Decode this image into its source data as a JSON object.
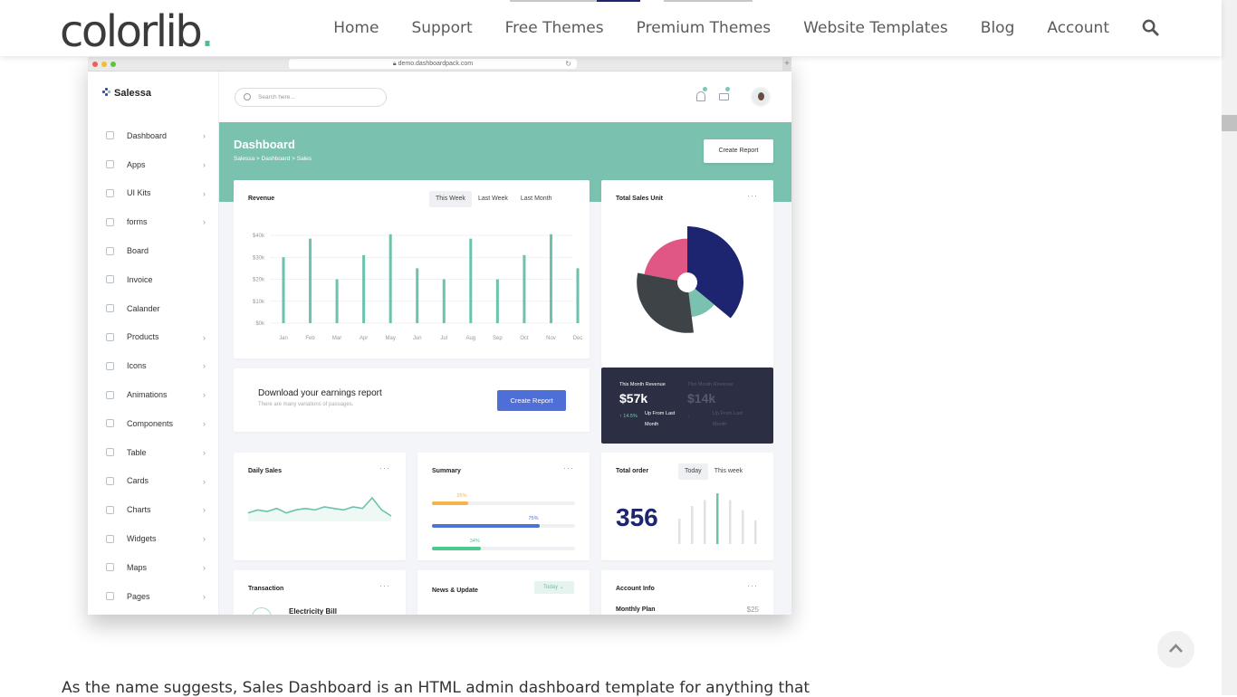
{
  "site": {
    "logo_text": "colorlib",
    "logo_dot": ".",
    "nav": [
      "Home",
      "Support",
      "Free Themes",
      "Premium Themes",
      "Website Templates",
      "Blog",
      "Account"
    ],
    "search_icon": "search-icon"
  },
  "browser": {
    "url": "demo.dashboardpack.com"
  },
  "app": {
    "brand": "Salessa",
    "search_placeholder": "Search here...",
    "menu": [
      {
        "label": "Dashboard",
        "chevron": true
      },
      {
        "label": "Apps",
        "chevron": true
      },
      {
        "label": "UI Kits",
        "chevron": true
      },
      {
        "label": "forms",
        "chevron": true
      },
      {
        "label": "Board",
        "chevron": false
      },
      {
        "label": "Invoice",
        "chevron": false
      },
      {
        "label": "Calander",
        "chevron": false
      },
      {
        "label": "Products",
        "chevron": true
      },
      {
        "label": "Icons",
        "chevron": true
      },
      {
        "label": "Animations",
        "chevron": true
      },
      {
        "label": "Components",
        "chevron": true
      },
      {
        "label": "Table",
        "chevron": true
      },
      {
        "label": "Cards",
        "chevron": true
      },
      {
        "label": "Charts",
        "chevron": true
      },
      {
        "label": "Widgets",
        "chevron": true
      },
      {
        "label": "Maps",
        "chevron": true
      },
      {
        "label": "Pages",
        "chevron": true
      }
    ],
    "banner": {
      "title": "Dashboard",
      "breadcrumb": "Salessa  >  Dashboard  >  Sales",
      "create_report": "Create Report"
    },
    "revenue": {
      "title": "Revenue",
      "tabs": [
        "This Week",
        "Last Week",
        "Last Month"
      ]
    },
    "total_sales_unit": {
      "title": "Total Sales Unit",
      "menu": "···"
    },
    "earnings": {
      "title": "Download your earnings report",
      "subtitle": "There are many variations of passages.",
      "button": "Create Report"
    },
    "month_revenue": [
      {
        "label": "This Month Revenue",
        "value": "$57k",
        "change": "14.5%",
        "note": "Up From Last Month"
      },
      {
        "label": "This Month Revenue",
        "value": "$14k",
        "change": "",
        "note": "Up From Last Month"
      }
    ],
    "daily_sales": {
      "title": "Daily Sales",
      "menu": "···"
    },
    "summary": {
      "title": "Summary",
      "menu": "···",
      "bars": [
        {
          "label": "25%",
          "value": 25,
          "color": "#f3b34a"
        },
        {
          "label": "75%",
          "value": 75,
          "color": "#4b74d6"
        },
        {
          "label": "34%",
          "value": 34,
          "color": "#4cc98c"
        }
      ]
    },
    "total_order": {
      "title": "Total order",
      "tabs": [
        "Today",
        "This week"
      ],
      "value": "356"
    },
    "transaction": {
      "title": "Transaction",
      "menu": "···",
      "item": "Electricity Bill"
    },
    "news": {
      "title": "News & Update",
      "dropdown": "Today"
    },
    "account_info": {
      "title": "Account Info",
      "menu": "···",
      "plan": "Monthly Plan",
      "price": "$25"
    }
  },
  "chart_data": [
    {
      "type": "bar",
      "title": "Revenue",
      "categories": [
        "Jan",
        "Feb",
        "Mar",
        "Apr",
        "May",
        "Jun",
        "Jul",
        "Aug",
        "Sep",
        "Oct",
        "Nov",
        "Dec"
      ],
      "values": [
        30,
        38.5,
        20,
        31,
        40.5,
        25,
        20,
        38.5,
        20,
        31,
        40.5,
        25
      ],
      "y_ticks": [
        "$40k",
        "$30k",
        "$20k",
        "$10k",
        "$0k"
      ],
      "ylim": [
        0,
        40
      ],
      "unit": "$k",
      "color": "#6cc2ad",
      "grid": true
    },
    {
      "type": "pie",
      "title": "Total Sales Unit",
      "slices": [
        {
          "value": 36,
          "radius": 1.0,
          "color": "#1d2470"
        },
        {
          "value": 12,
          "radius": 0.62,
          "color": "#7ac1b0"
        },
        {
          "value": 30,
          "radius": 0.9,
          "color": "#3d4347"
        },
        {
          "value": 22,
          "radius": 0.78,
          "color": "#e05684"
        }
      ]
    },
    {
      "type": "line",
      "title": "Daily Sales",
      "values": [
        5,
        6,
        5.5,
        6.5,
        5,
        6,
        6.5,
        6,
        7,
        6.5,
        6,
        7,
        6.5,
        10,
        6,
        4
      ],
      "color": "#6cc2ad"
    },
    {
      "type": "bar",
      "title": "Total order",
      "values": [
        30,
        45,
        52,
        60,
        52,
        40,
        28
      ],
      "highlight": 3,
      "color": "#dfe2e6",
      "highlight_color": "#6cc2ad"
    }
  ]
}
